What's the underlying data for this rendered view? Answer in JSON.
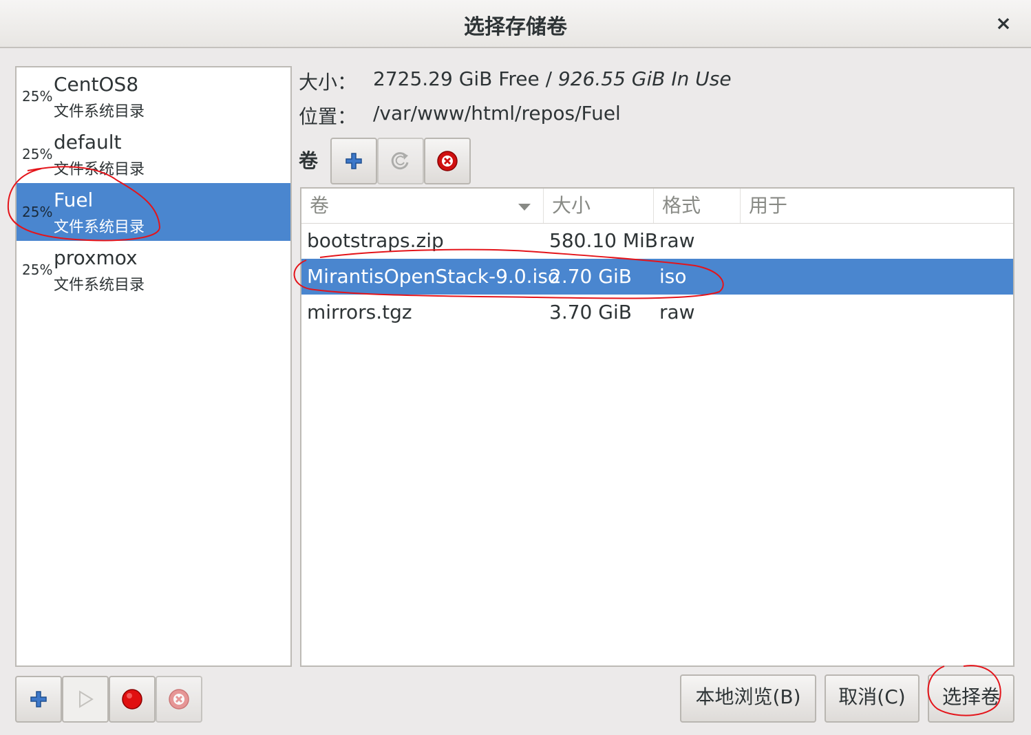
{
  "window": {
    "title": "选择存储卷",
    "close": "×"
  },
  "pools": [
    {
      "usage": "25%",
      "name": "CentOS8",
      "type": "文件系统目录",
      "selected": false
    },
    {
      "usage": "25%",
      "name": "default",
      "type": "文件系统目录",
      "selected": false
    },
    {
      "usage": "25%",
      "name": "Fuel",
      "type": "文件系统目录",
      "selected": true
    },
    {
      "usage": "25%",
      "name": "proxmox",
      "type": "文件系统目录",
      "selected": false
    }
  ],
  "info": {
    "size_label": "大小：",
    "size_free": "2725.29 GiB Free /",
    "size_inuse": " 926.55 GiB In Use",
    "location_label": "位置：",
    "location_value": "/var/www/html/repos/Fuel",
    "volumes_label": "卷"
  },
  "toolbar": {
    "add_icon": "plus-icon",
    "refresh_icon": "refresh-icon",
    "delete_icon": "delete-circle-icon"
  },
  "table": {
    "headers": [
      "卷",
      "大小",
      "格式",
      "用于"
    ],
    "rows": [
      {
        "name": "bootstraps.zip",
        "size": "580.10 MiB",
        "format": "raw",
        "used": "",
        "selected": false
      },
      {
        "name": "MirantisOpenStack-9.0.iso",
        "size": "2.70 GiB",
        "format": "iso",
        "used": "",
        "selected": true
      },
      {
        "name": "mirrors.tgz",
        "size": "3.70 GiB",
        "format": "raw",
        "used": "",
        "selected": false
      }
    ]
  },
  "pool_toolbar": {
    "add_icon": "plus-icon",
    "start_icon": "play-icon",
    "stop_icon": "record-stop-icon",
    "delete_icon": "delete-circle-icon"
  },
  "buttons": {
    "browse_local": "本地浏览(B)",
    "cancel": "取消(C)",
    "choose": "选择卷"
  },
  "colors": {
    "selection": "#4a86cf",
    "accent_blue": "#3465a4",
    "stop_red": "#cc0000"
  }
}
